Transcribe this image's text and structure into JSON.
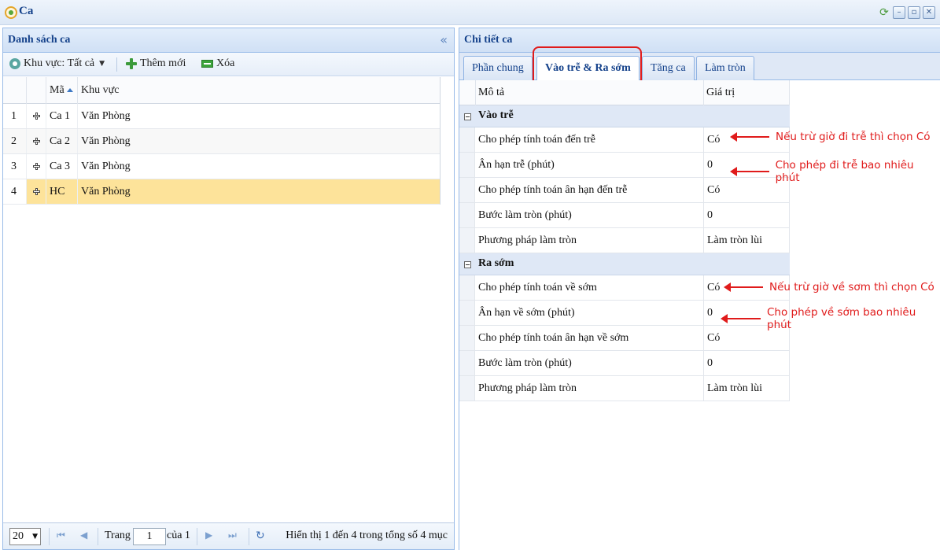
{
  "window": {
    "title": "Ca",
    "icon": "app-logo-icon"
  },
  "left_panel": {
    "title": "Danh sách ca",
    "collapse_icon": "collapse-left-icon",
    "toolbar": {
      "region_filter": "Khu vực: Tất cả",
      "add_label": "Thêm mới",
      "delete_label": "Xóa"
    },
    "columns": {
      "code": "Mã",
      "area": "Khu vực"
    },
    "rows": [
      {
        "num": "1",
        "code": "Ca 1",
        "area": "Văn Phòng"
      },
      {
        "num": "2",
        "code": "Ca 2",
        "area": "Văn Phòng"
      },
      {
        "num": "3",
        "code": "Ca 3",
        "area": "Văn Phòng"
      },
      {
        "num": "4",
        "code": "HC",
        "area": "Văn Phòng"
      }
    ],
    "selected_row_color": "#fde39a",
    "pager": {
      "page_size": "20",
      "page_label": "Trang",
      "page_value": "1",
      "of_label": "của 1",
      "summary": "Hiển thị 1 đến 4 trong tổng số 4 mục"
    }
  },
  "right_panel": {
    "title": "Chi tiết ca",
    "tabs": [
      {
        "label": "Phần chung"
      },
      {
        "label": "Vào trễ & Ra sớm"
      },
      {
        "label": "Tăng ca"
      },
      {
        "label": "Làm tròn"
      }
    ],
    "active_tab": "Vào trễ & Ra sớm",
    "columns": {
      "desc": "Mô tả",
      "value": "Giá trị"
    },
    "groups": [
      {
        "title": "Vào trễ",
        "items": [
          {
            "name": "Cho phép tính toán đến trễ",
            "value": "Có"
          },
          {
            "name": "Ân hạn trễ (phút)",
            "value": "0"
          },
          {
            "name": "Cho phép tính toán ân hạn đến trễ",
            "value": "Có"
          },
          {
            "name": "Bước làm tròn (phút)",
            "value": "0"
          },
          {
            "name": "Phương pháp làm tròn",
            "value": "Làm tròn lùi"
          }
        ]
      },
      {
        "title": "Ra sớm",
        "items": [
          {
            "name": "Cho phép tính toán về sớm",
            "value": "Có"
          },
          {
            "name": "Ân hạn về sớm (phút)",
            "value": "0"
          },
          {
            "name": "Cho phép tính toán ân hạn về sớm",
            "value": "Có"
          },
          {
            "name": "Bước làm tròn (phút)",
            "value": "0"
          },
          {
            "name": "Phương pháp làm tròn",
            "value": "Làm tròn lùi"
          }
        ]
      }
    ]
  },
  "annotations": [
    "Nếu trừ giờ đi trễ thì chọn Có",
    "Cho phép đi trễ bao nhiêu phút",
    "Nếu trừ giờ về sơm thì chọn Có",
    "Cho phép về sớm bao nhiêu phút"
  ],
  "annotation_color": "#e01b1b"
}
